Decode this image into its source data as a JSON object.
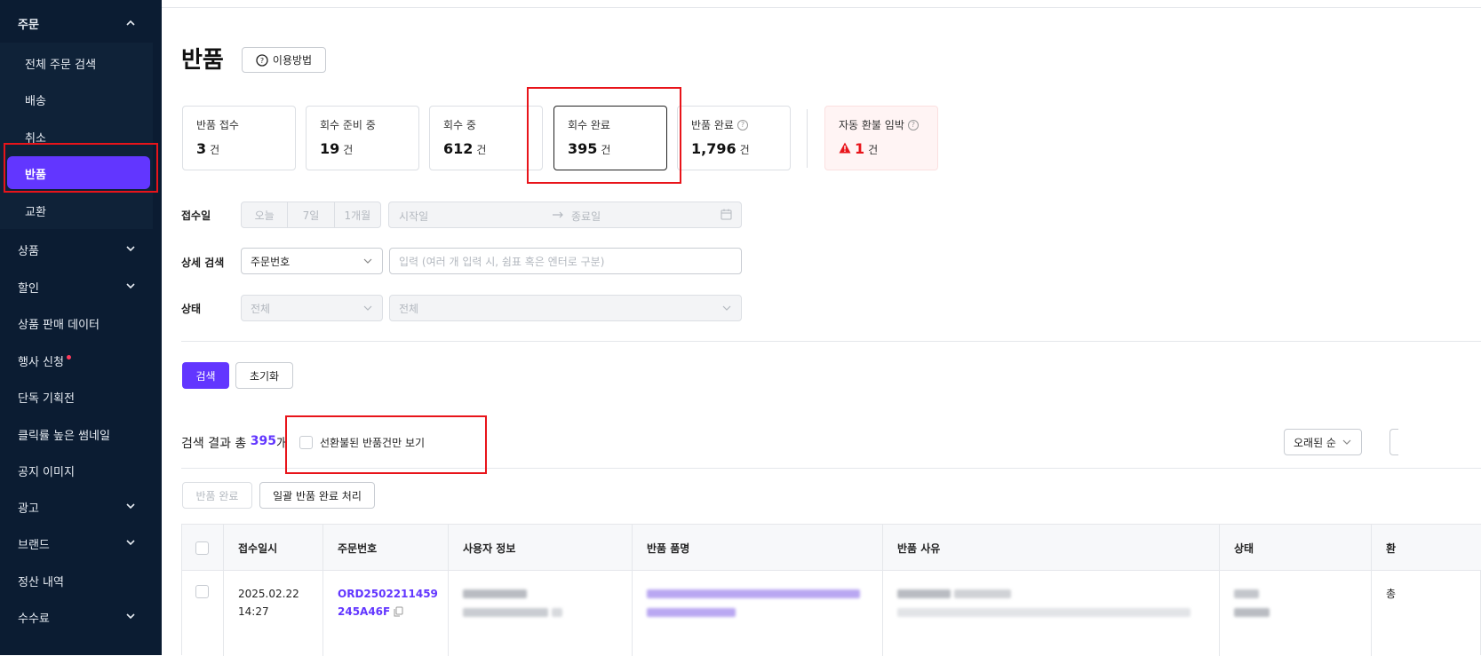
{
  "sidebar": {
    "group_order": "주문",
    "sub_items": [
      "전체 주문 검색",
      "배송",
      "취소",
      "반품",
      "교환"
    ],
    "active_item": "반품",
    "items": [
      {
        "label": "상품",
        "has_chevron": true
      },
      {
        "label": "할인",
        "has_chevron": true
      },
      {
        "label": "상품 판매 데이터",
        "has_chevron": false
      },
      {
        "label": "행사 신청",
        "has_chevron": false,
        "dot": true
      },
      {
        "label": "단독 기획전",
        "has_chevron": false
      },
      {
        "label": "클릭률 높은 썸네일",
        "has_chevron": false
      },
      {
        "label": "공지 이미지",
        "has_chevron": false
      },
      {
        "label": "광고",
        "has_chevron": true
      },
      {
        "label": "브랜드",
        "has_chevron": true
      },
      {
        "label": "정산 내역",
        "has_chevron": false
      },
      {
        "label": "수수료",
        "has_chevron": true
      }
    ]
  },
  "page": {
    "title": "반품",
    "help_label": "이용방법"
  },
  "stats": [
    {
      "label": "반품 접수",
      "value": "3",
      "unit": "건"
    },
    {
      "label": "회수 준비 중",
      "value": "19",
      "unit": "건"
    },
    {
      "label": "회수 중",
      "value": "612",
      "unit": "건"
    },
    {
      "label": "회수 완료",
      "value": "395",
      "unit": "건",
      "selected": true
    },
    {
      "label": "반품 완료",
      "value": "1,796",
      "unit": "건",
      "help": true
    }
  ],
  "urgent": {
    "label": "자동 환불 임박",
    "value": "1",
    "unit": "건"
  },
  "filters": {
    "date_label": "접수일",
    "date_presets": [
      "오늘",
      "7일",
      "1개월"
    ],
    "start_placeholder": "시작일",
    "end_placeholder": "종료일",
    "detail_label": "상세 검색",
    "detail_type": "주문번호",
    "detail_placeholder": "입력 (여러 개 입력 시, 쉼표 혹은 엔터로 구분)",
    "status_label": "상태",
    "status_1": "전체",
    "status_2": "전체"
  },
  "actions": {
    "search": "검색",
    "reset": "초기화"
  },
  "results": {
    "prefix": "검색 결과 총 ",
    "count": "395",
    "suffix": "개",
    "filter_checkbox": "선환불된 반품건만 보기",
    "sort": "오래된 순",
    "btn_complete": "반품 완료",
    "btn_bulk": "일괄 반품 완료 처리"
  },
  "table": {
    "headers": [
      "접수일시",
      "주문번호",
      "사용자 정보",
      "반품 품명",
      "반품 사유",
      "상태",
      "환"
    ],
    "rows": [
      {
        "date": "2025.02.22",
        "time": "14:27",
        "order_1": "ORD2502211459",
        "order_2": "245A46F",
        "partial": "총"
      }
    ]
  },
  "colors": {
    "sidebar_bg": "#0b1c32",
    "accent": "#6236ff",
    "highlight": "#e8141a"
  }
}
